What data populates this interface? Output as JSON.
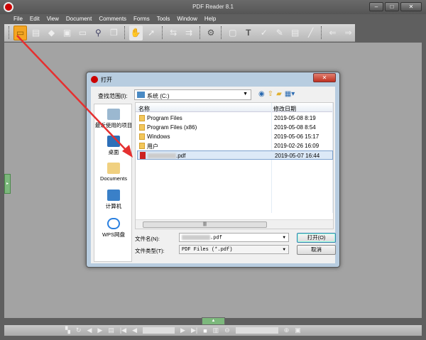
{
  "window": {
    "title": "PDF Reader 8.1",
    "minimize": "–",
    "maximize": "□",
    "close": "✕"
  },
  "menu": [
    {
      "label": "File"
    },
    {
      "label": "Edit"
    },
    {
      "label": "View"
    },
    {
      "label": "Document"
    },
    {
      "label": "Comments"
    },
    {
      "label": "Forms"
    },
    {
      "label": "Tools"
    },
    {
      "label": "Window"
    },
    {
      "label": "Help"
    }
  ],
  "dialog": {
    "title": "打开",
    "close": "✕",
    "look_in_label": "查找范围(I):",
    "look_in_value": "系统 (C:)",
    "places": [
      {
        "label": "最近使用的项目"
      },
      {
        "label": "桌面"
      },
      {
        "label": "Documents"
      },
      {
        "label": "计算机"
      },
      {
        "label": "WPS网盘"
      }
    ],
    "columns": {
      "name": "名称",
      "date": "修改日期"
    },
    "files": [
      {
        "name": "Program Files",
        "date": "2019-05-08 8:19",
        "type": "folder"
      },
      {
        "name": "Program Files (x86)",
        "date": "2019-05-08 8:54",
        "type": "folder"
      },
      {
        "name": "Windows",
        "date": "2019-05-06 15:17",
        "type": "folder"
      },
      {
        "name": "用户",
        "date": "2019-02-26 16:09",
        "type": "folder"
      },
      {
        "name": ".pdf",
        "date": "2019-05-07 16:44",
        "type": "pdf",
        "selected": true
      }
    ],
    "file_name_label": "文件名(N):",
    "file_name_value": ".pdf",
    "file_type_label": "文件类型(T):",
    "file_type_value": "PDF Files (*.pdf)",
    "open_button": "打开(O)",
    "cancel_button": "取消"
  },
  "colors": {
    "accent": "#f5a623",
    "arrow": "#e53030"
  }
}
